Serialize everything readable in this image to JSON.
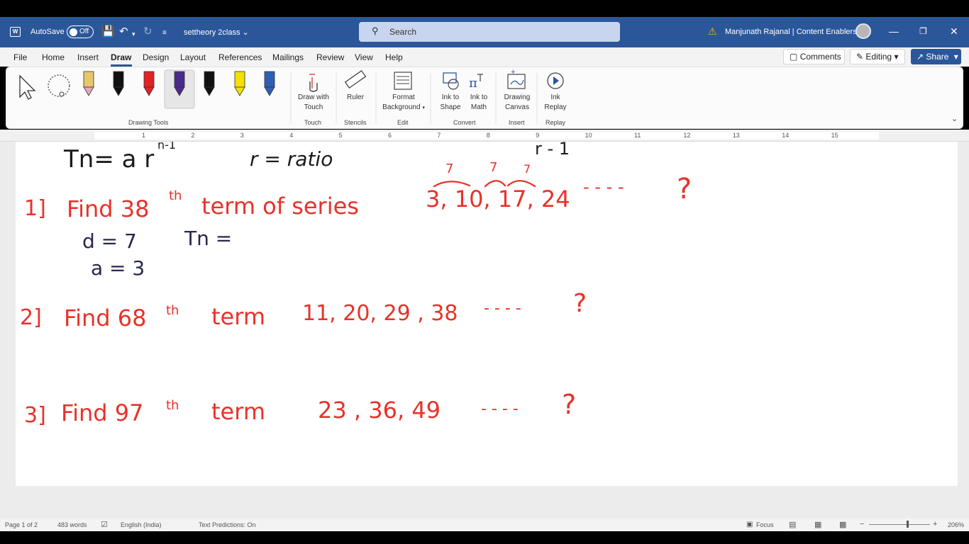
{
  "titlebar": {
    "autosave_label": "AutoSave",
    "autosave_state": "Off",
    "doc_name": "settheory 2class",
    "search_placeholder": "Search",
    "user": "Manjunath Rajanal | Content Enablers"
  },
  "menu": {
    "tabs": [
      "File",
      "Home",
      "Insert",
      "Draw",
      "Design",
      "Layout",
      "References",
      "Mailings",
      "Review",
      "View",
      "Help"
    ],
    "active": "Draw",
    "comments": "Comments",
    "editing": "Editing",
    "share": "Share"
  },
  "ribbon": {
    "draw_with_touch": [
      "Draw with",
      "Touch"
    ],
    "ruler": "Ruler",
    "format_background": [
      "Format",
      "Background"
    ],
    "ink_to_shape": [
      "Ink to",
      "Shape"
    ],
    "ink_to_math": [
      "Ink to",
      "Math"
    ],
    "drawing_canvas": [
      "Drawing",
      "Canvas"
    ],
    "ink_replay": [
      "Ink",
      "Replay"
    ],
    "groups": [
      "Drawing Tools",
      "Touch",
      "Stencils",
      "Edit",
      "Convert",
      "Insert",
      "Replay"
    ],
    "pen_colors": [
      "#e8c66a",
      "#111111",
      "#e02424",
      "#4b2a8c",
      "#111111",
      "#f5e000",
      "#2e5fb5"
    ]
  },
  "ruler_numbers": [
    "1",
    "2",
    "3",
    "4",
    "5",
    "6",
    "7",
    "8",
    "9",
    "10",
    "11",
    "12",
    "13",
    "14",
    "15"
  ],
  "document": {
    "line0_left": "Tn= a r",
    "line0_exp": "n-1",
    "line0_mid": "r = ratio",
    "line0_right": "r - 1",
    "q1_num": "1]",
    "q1_text": "Find 38",
    "q1_sup": "th",
    "q1_rest": "term of series",
    "q1_series": "3, 10, 17, 24",
    "q1_diffs": [
      "7",
      "7",
      "7"
    ],
    "q1_dots": "- - - -",
    "q1_d": "d = 7",
    "q1_tn": "Tn =",
    "q1_a": "a = 3",
    "q2_num": "2]",
    "q2_text": "Find 68",
    "q2_sup": "th",
    "q2_rest": "term",
    "q2_series": "11, 20, 29 , 38",
    "q2_dots": "- - - -",
    "q3_num": "3]",
    "q3_text": "Find 97",
    "q3_sup": "th",
    "q3_rest": "term",
    "q3_series": "23 , 36, 49",
    "q3_dots": "- - - -",
    "question_mark": "?"
  },
  "status": {
    "page": "Page 1 of 2",
    "words": "483 words",
    "language": "English (India)",
    "predictions": "Text Predictions: On",
    "focus": "Focus",
    "zoom": "206%"
  },
  "colors": {
    "title_blue": "#2b579a",
    "ink_red": "#e8322a",
    "ink_blue": "#26284f"
  }
}
